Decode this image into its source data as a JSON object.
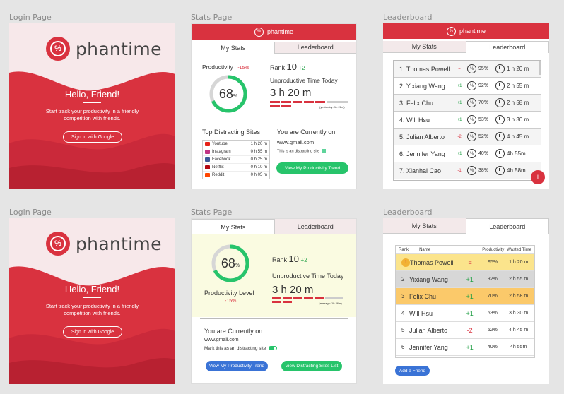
{
  "labels": {
    "login_top": "Login Page",
    "stats_top": "Stats Page",
    "leader_top": "Leaderboard",
    "login_bottom": "Login Page",
    "stats_bottom": "Stats Page",
    "leader_bottom": "Leaderboard"
  },
  "brand": {
    "name": "phantime",
    "icon": "percent-logo-icon"
  },
  "login": {
    "greeting": "Hello, Friend!",
    "tagline": "Start track your productivity in a friendly competition with friends.",
    "signin_label": "Sign in with Google"
  },
  "tabs": {
    "stats": "My Stats",
    "leader": "Leaderboard"
  },
  "stats_a": {
    "productivity_label": "Productivity",
    "productivity_change": "-15%",
    "productivity_value": "68",
    "productivity_unit": "%",
    "productivity_level": 0.68,
    "rank_label": "Rank",
    "rank_value": "10",
    "rank_change": "+2",
    "unproductive_label": "Unproductive Time Today",
    "unproductive_value": "3 h 20 m",
    "average_note": "(yesterday: 1h 26m)",
    "distracting_title": "Top Distracting Sites",
    "sites": [
      {
        "name": "Youtube",
        "time": "1 h 20 m",
        "color": "#e62117"
      },
      {
        "name": "Instagram",
        "time": "0 h 55 m",
        "color": "#c13584"
      },
      {
        "name": "Facebook",
        "time": "0 h 25 m",
        "color": "#3b5998"
      },
      {
        "name": "Netflix",
        "time": "0 h 10 m",
        "color": "#b20710"
      },
      {
        "name": "Reddit",
        "time": "0 h 05 m",
        "color": "#ff4500"
      }
    ],
    "current_title": "You are Currently on",
    "current_site": "www.gmail.com",
    "current_note": "This is an distracting site",
    "view_trend_label": "View My Productivity Trend"
  },
  "stats_b": {
    "productivity_value": "68",
    "productivity_unit": "%",
    "productivity_level": 0.68,
    "productivity_level_label": "Productivity Level",
    "productivity_change": "-15%",
    "rank_label": "Rank",
    "rank_value": "10",
    "rank_change": "+2",
    "unproductive_label": "Unproductive Time Today",
    "unproductive_value": "3 h 20 m",
    "average_note": "(average: 1h 26m)",
    "current_title": "You are Currently on",
    "current_site": "www.gmail.com",
    "mark_label": "Mark this as an distracting site",
    "view_trend_label": "View My Productivity Trend",
    "view_sites_label": "View Distracting Sites List"
  },
  "leader_a": {
    "rows": [
      {
        "name": "1. Thomas Powell",
        "change": "=",
        "pct": "95%",
        "time": "1 h 20 m",
        "change_color": "#d9323f"
      },
      {
        "name": "2. Yixiang Wang",
        "change": "+1",
        "pct": "92%",
        "time": "2 h 55 m",
        "change_color": "#24a148"
      },
      {
        "name": "3. Felix Chu",
        "change": "+1",
        "pct": "70%",
        "time": "2 h 58 m",
        "change_color": "#24a148"
      },
      {
        "name": "4. Will Hsu",
        "change": "+1",
        "pct": "53%",
        "time": "3 h 30 m",
        "change_color": "#24a148"
      },
      {
        "name": "5. Julian Alberto",
        "change": "-2",
        "pct": "52%",
        "time": "4 h 45 m",
        "change_color": "#d9323f"
      },
      {
        "name": "6. Jennifer Yang",
        "change": "+1",
        "pct": "40%",
        "time": "4h 55m",
        "change_color": "#24a148"
      },
      {
        "name": "7. Xianhai Cao",
        "change": "-1",
        "pct": "38%",
        "time": "4h 58m",
        "change_color": "#d9323f"
      }
    ]
  },
  "leader_b": {
    "headers": {
      "rank": "Rank",
      "name": "Name",
      "productivity": "Productivity",
      "wasted": "Wasted Time"
    },
    "rows": [
      {
        "rank": "",
        "name": "Thomas Powell",
        "change": "=",
        "pct": "95%",
        "time": "1 h 20 m",
        "bg": "#fbe48c",
        "change_color": "#d9323f",
        "medal": true
      },
      {
        "rank": "2",
        "name": "Yixiang Wang",
        "change": "+1",
        "pct": "92%",
        "time": "2 h 55 m",
        "bg": "#d7d7d7",
        "change_color": "#24a148",
        "medal": false
      },
      {
        "rank": "3",
        "name": "Felix Chu",
        "change": "+1",
        "pct": "70%",
        "time": "2 h 58 m",
        "bg": "#fbc96a",
        "change_color": "#24a148",
        "medal": false
      },
      {
        "rank": "4",
        "name": "Will Hsu",
        "change": "+1",
        "pct": "53%",
        "time": "3 h 30 m",
        "bg": "#ffffff",
        "change_color": "#24a148",
        "medal": false
      },
      {
        "rank": "5",
        "name": "Julian Alberto",
        "change": "-2",
        "pct": "52%",
        "time": "4 h 45 m",
        "bg": "#ffffff",
        "change_color": "#d9323f",
        "medal": false
      },
      {
        "rank": "6",
        "name": "Jennifer Yang",
        "change": "+1",
        "pct": "40%",
        "time": "4h 55m",
        "bg": "#ffffff",
        "change_color": "#24a148",
        "medal": false
      }
    ],
    "add_friend_label": "Add a Friend"
  },
  "colors": {
    "brand_red": "#d9323f",
    "accent_green": "#27c46b",
    "accent_blue": "#3a73d6"
  }
}
